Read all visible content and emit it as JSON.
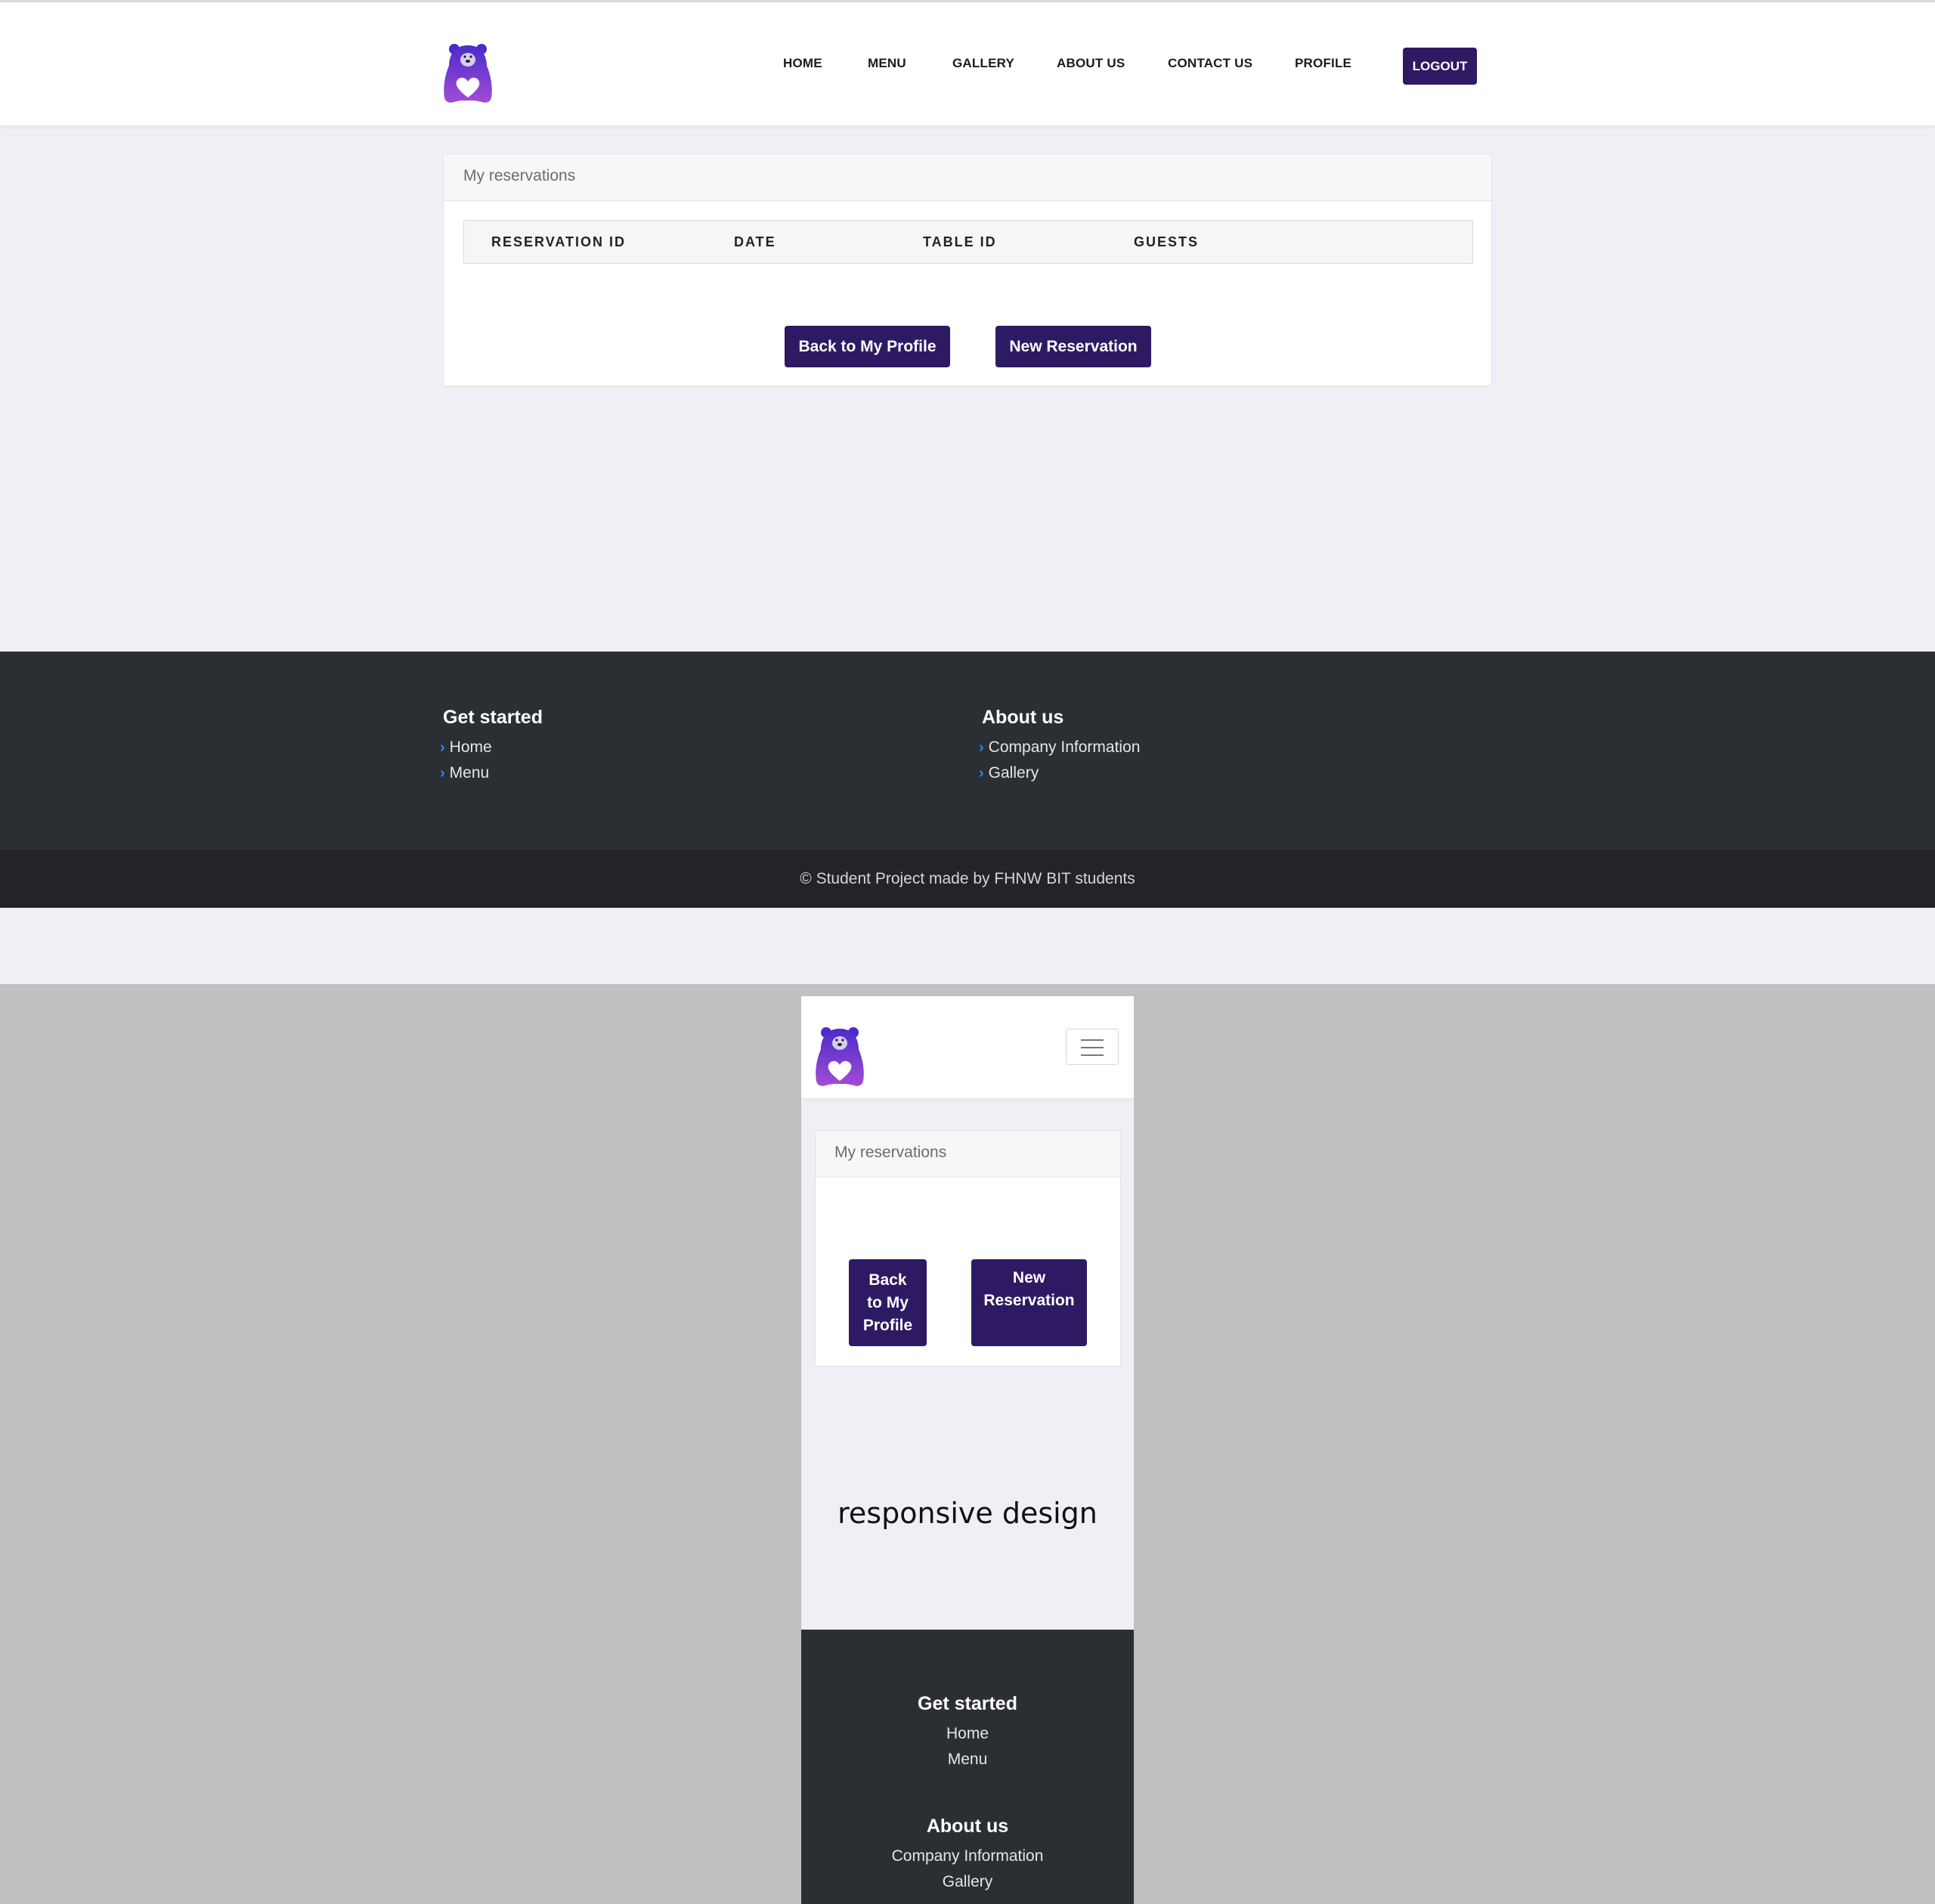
{
  "nav": {
    "items": [
      "HOME",
      "MENU",
      "GALLERY",
      "ABOUT US",
      "CONTACT US",
      "PROFILE"
    ],
    "logout": "LOGOUT"
  },
  "reservations": {
    "title": "My reservations",
    "columns": [
      "RESERVATION ID",
      "DATE",
      "TABLE ID",
      "GUESTS"
    ],
    "back_button": "Back to My Profile",
    "new_button": "New Reservation"
  },
  "footer": {
    "get_started": {
      "title": "Get started",
      "links": [
        "Home",
        "Menu"
      ]
    },
    "about_us": {
      "title": "About us",
      "links": [
        "Company Information",
        "Gallery"
      ]
    },
    "copyright": "© Student Project made by FHNW BIT students"
  },
  "mobile": {
    "back_button_lines": [
      "Back",
      "to My",
      "Profile"
    ],
    "new_button_lines": [
      "New",
      "Reservation"
    ],
    "caption": "responsive design"
  },
  "colors": {
    "primary": "#2d1a63",
    "footer_bg": "#2b2e33",
    "copyright_bg": "#222428",
    "page_bg": "#eff0f5",
    "link_chevron": "#1e90ff"
  },
  "icons": {
    "logo": "bear-heart-logo",
    "menu_toggle": "hamburger-icon",
    "footer_bullet": "chevron-right-icon"
  }
}
